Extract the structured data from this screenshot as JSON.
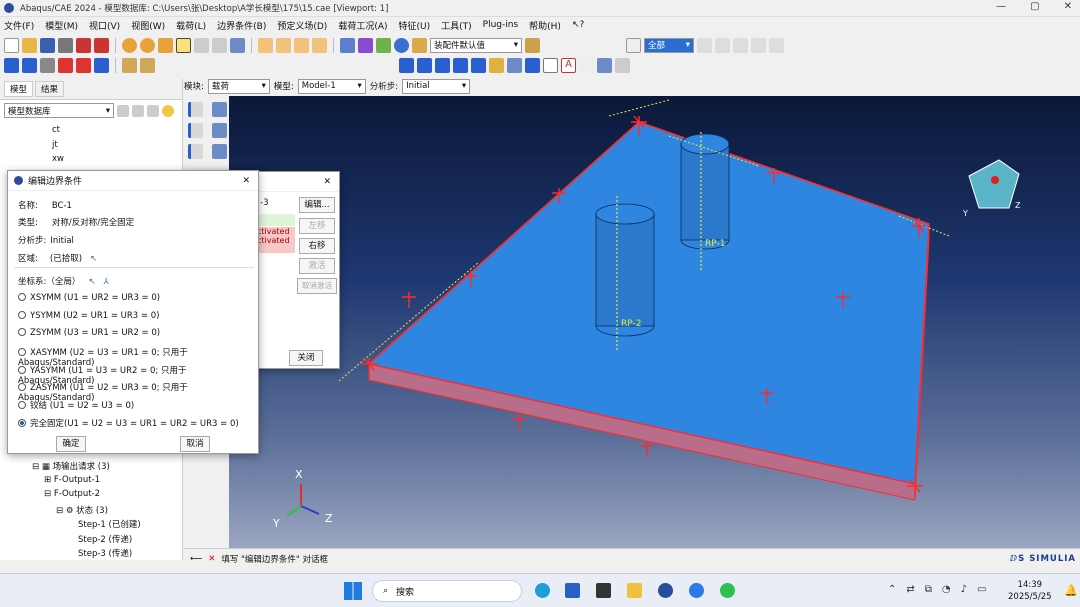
{
  "window": {
    "title": "Abaqus/CAE 2024 - 模型数据库: C:\\Users\\张\\Desktop\\A学长模型\\175\\15.cae [Viewport: 1]",
    "min": "—",
    "max": "▢",
    "close": "✕"
  },
  "menu": [
    "文件(F)",
    "模型(M)",
    "视口(V)",
    "视图(W)",
    "载荷(L)",
    "边界条件(B)",
    "预定义场(D)",
    "载荷工况(A)",
    "特征(U)",
    "工具(T)",
    "Plug-ins",
    "帮助(H)"
  ],
  "toolbar": {
    "part_instance_combo": "装配件默认值",
    "select_all": "全部"
  },
  "context": {
    "module_label": "模块:",
    "module": "载荷",
    "model_label": "模型:",
    "model": "Model-1",
    "step_label": "分析步:",
    "step": "Initial"
  },
  "left_tabs": [
    "模型",
    "结果"
  ],
  "left_combo": "模型数据库",
  "tree_top": [
    "ct",
    "jt",
    "xw",
    "…"
  ],
  "tree_bottom": [
    "场输出请求 (3)",
    "F-Output-1",
    "F-Output-2",
    "状态 (3)",
    "Step-1 (已创建)",
    "Step-2 (传递)",
    "Step-3 (传递)",
    "…"
  ],
  "manager_dialog": {
    "col": "-3",
    "rows": [
      "ctivated",
      "ctivated"
    ],
    "btn_edit": "编辑...",
    "btn_left": "左移",
    "btn_right": "右移",
    "btn_activate": "激活",
    "btn_deactivate": "取消激活",
    "btn_close": "关闭"
  },
  "edit_dialog": {
    "title": "编辑边界条件",
    "name_label": "名称:",
    "name": "BC-1",
    "type_label": "类型:",
    "type": "对称/反对称/完全固定",
    "step_label": "分析步:",
    "step": "Initial",
    "region_label": "区域:",
    "region": "(已拾取)",
    "csys_label": "坐标系:（全局）",
    "options": [
      "XSYMM (U1 = UR2 = UR3 = 0)",
      "YSYMM (U2 = UR1 = UR3 = 0)",
      "ZSYMM (U3 = UR1 = UR2 = 0)",
      "XASYMM (U2 = U3 = UR1 = 0; 只用于 Abaqus/Standard)",
      "YASYMM (U1 = U3 = UR2 = 0; 只用于 Abaqus/Standard)",
      "ZASYMM (U1 = U2 = UR3 = 0; 只用于 Abaqus/Standard)",
      "铰结 (U1 = U2 = U3 = 0)",
      "完全固定(U1 = U2 = U3 = UR1 = UR2 = UR3 = 0)"
    ],
    "selected": 7,
    "ok": "确定",
    "cancel": "取消"
  },
  "viewport": {
    "rp1": "RP-1",
    "rp2": "RP-2",
    "axes": {
      "x": "X",
      "y": "Y",
      "z": "Z"
    }
  },
  "status": {
    "text": "填写 \"编辑边界条件\" 对话框",
    "brand": "SIMULIA"
  },
  "taskbar": {
    "search": "搜索",
    "time": "14:39",
    "date": "2025/5/25"
  },
  "colors": {
    "plate": "#2f86e0",
    "bc": "#ff2222",
    "accent": "#1a5fb4"
  }
}
